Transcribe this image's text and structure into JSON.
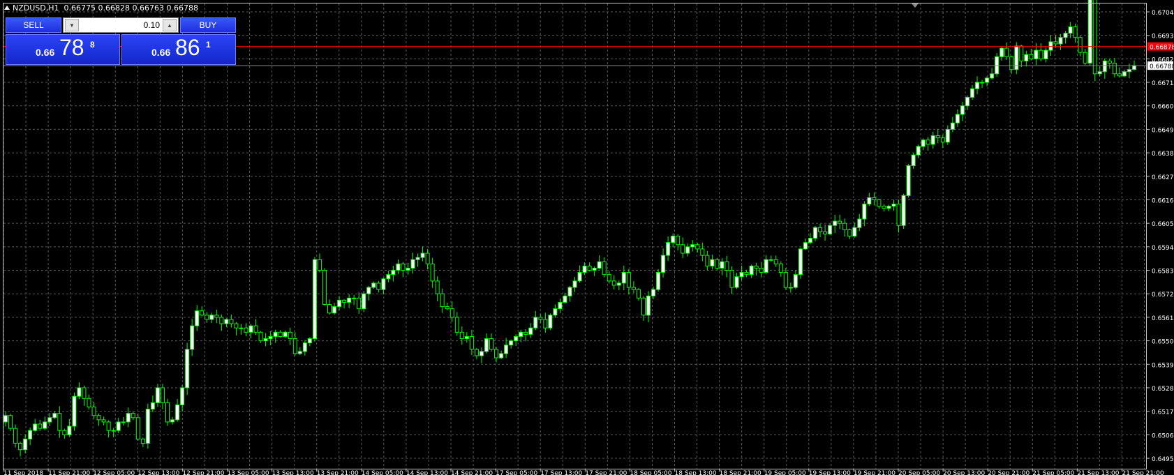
{
  "window": {
    "symbol": "NZDUSD,H1",
    "ohlc": "0.66775 0.66828 0.66763 0.66788"
  },
  "trade_panel": {
    "sell_label": "SELL",
    "buy_label": "BUY",
    "lot_value": "0.10",
    "sell_price": {
      "prefix": "0.66",
      "big": "78",
      "sup": "8"
    },
    "buy_price": {
      "prefix": "0.66",
      "big": "86",
      "sup": "1"
    }
  },
  "price_axis": {
    "ticks": [
      "0.67040",
      "0.66930",
      "0.66820",
      "0.66710",
      "0.66600",
      "0.66490",
      "0.66380",
      "0.66270",
      "0.66160",
      "0.66050",
      "0.65940",
      "0.65830",
      "0.65720",
      "0.65610",
      "0.65500",
      "0.65390",
      "0.65280",
      "0.65170",
      "0.65060",
      "0.64950"
    ],
    "ask_line": "0.66878",
    "bid_line": "0.66788"
  },
  "time_axis": {
    "ticks": [
      "11 Sep 2018",
      "11 Sep 21:00",
      "12 Sep 05:00",
      "12 Sep 13:00",
      "12 Sep 21:00",
      "13 Sep 05:00",
      "13 Sep 13:00",
      "13 Sep 21:00",
      "14 Sep 05:00",
      "14 Sep 13:00",
      "14 Sep 21:00",
      "17 Sep 05:00",
      "17 Sep 13:00",
      "17 Sep 21:00",
      "18 Sep 05:00",
      "18 Sep 13:00",
      "18 Sep 21:00",
      "19 Sep 05:00",
      "19 Sep 13:00",
      "19 Sep 21:00",
      "20 Sep 05:00",
      "20 Sep 13:00",
      "20 Sep 21:00",
      "21 Sep 05:00",
      "21 Sep 13:00",
      "21 Sep 21:00"
    ]
  },
  "colors": {
    "background": "#000000",
    "grid": "#5a5a5a",
    "candle": "#00ff00",
    "bull_body": "#ffffff",
    "bear_body": "#000000",
    "ask_line": "#ff0000",
    "bid_line": "#8c8c8c",
    "axis_text": "#ffffff"
  },
  "chart_data": {
    "type": "candlestick",
    "symbol": "NZDUSD",
    "timeframe": "H1",
    "ylim": [
      0.6495,
      0.6704
    ],
    "candles_close": [
      0.6515,
      0.6509,
      0.6502,
      0.6499,
      0.6504,
      0.6508,
      0.6511,
      0.6509,
      0.6512,
      0.6514,
      0.6516,
      0.6508,
      0.6506,
      0.651,
      0.6524,
      0.6528,
      0.6523,
      0.6519,
      0.6515,
      0.6513,
      0.6512,
      0.6508,
      0.6508,
      0.6512,
      0.6512,
      0.6516,
      0.6514,
      0.6504,
      0.6502,
      0.6518,
      0.6521,
      0.6528,
      0.6521,
      0.6512,
      0.6513,
      0.652,
      0.6528,
      0.6546,
      0.6557,
      0.6564,
      0.6562,
      0.656,
      0.6562,
      0.6561,
      0.6558,
      0.656,
      0.6558,
      0.6556,
      0.6556,
      0.6554,
      0.6557,
      0.6554,
      0.655,
      0.6551,
      0.6552,
      0.6554,
      0.6552,
      0.6554,
      0.6551,
      0.6544,
      0.6545,
      0.6549,
      0.6551,
      0.6588,
      0.6583,
      0.6567,
      0.6563,
      0.6566,
      0.6569,
      0.6568,
      0.657,
      0.657,
      0.6565,
      0.6572,
      0.6575,
      0.6577,
      0.6574,
      0.6579,
      0.6581,
      0.6583,
      0.6586,
      0.6583,
      0.6584,
      0.6588,
      0.6589,
      0.6591,
      0.6586,
      0.6578,
      0.6572,
      0.6566,
      0.6565,
      0.6561,
      0.6554,
      0.6551,
      0.6552,
      0.6546,
      0.6543,
      0.6545,
      0.6551,
      0.6546,
      0.6542,
      0.6544,
      0.6548,
      0.655,
      0.6552,
      0.6554,
      0.6553,
      0.6556,
      0.6561,
      0.656,
      0.6556,
      0.6562,
      0.6565,
      0.6568,
      0.6571,
      0.6575,
      0.6578,
      0.6582,
      0.6585,
      0.6583,
      0.6584,
      0.6587,
      0.6581,
      0.6578,
      0.6576,
      0.6577,
      0.6582,
      0.6575,
      0.6574,
      0.657,
      0.6562,
      0.6571,
      0.6574,
      0.6582,
      0.659,
      0.6596,
      0.6599,
      0.6595,
      0.6591,
      0.6594,
      0.6595,
      0.6593,
      0.659,
      0.6585,
      0.6588,
      0.6584,
      0.6587,
      0.6583,
      0.6575,
      0.658,
      0.6582,
      0.6581,
      0.6585,
      0.6584,
      0.6582,
      0.6588,
      0.6588,
      0.6586,
      0.6582,
      0.6575,
      0.6575,
      0.6581,
      0.6593,
      0.6596,
      0.6598,
      0.6603,
      0.6601,
      0.66,
      0.6604,
      0.6606,
      0.6605,
      0.6602,
      0.6599,
      0.6603,
      0.6607,
      0.6614,
      0.6617,
      0.6616,
      0.6613,
      0.6612,
      0.6613,
      0.6614,
      0.6604,
      0.6618,
      0.6632,
      0.6637,
      0.6641,
      0.6644,
      0.6642,
      0.6646,
      0.6645,
      0.6643,
      0.6649,
      0.6652,
      0.6656,
      0.666,
      0.6664,
      0.6668,
      0.6671,
      0.6671,
      0.6673,
      0.6675,
      0.6683,
      0.6687,
      0.6683,
      0.6677,
      0.6688,
      0.6681,
      0.6684,
      0.6682,
      0.6686,
      0.6682,
      0.6686,
      0.669,
      0.6689,
      0.6692,
      0.6694,
      0.6697,
      0.6692,
      0.6685,
      0.668,
      0.6779,
      0.6675,
      0.6676,
      0.6681,
      0.668,
      0.6675,
      0.6674,
      0.6676,
      0.6677,
      0.66788
    ]
  }
}
